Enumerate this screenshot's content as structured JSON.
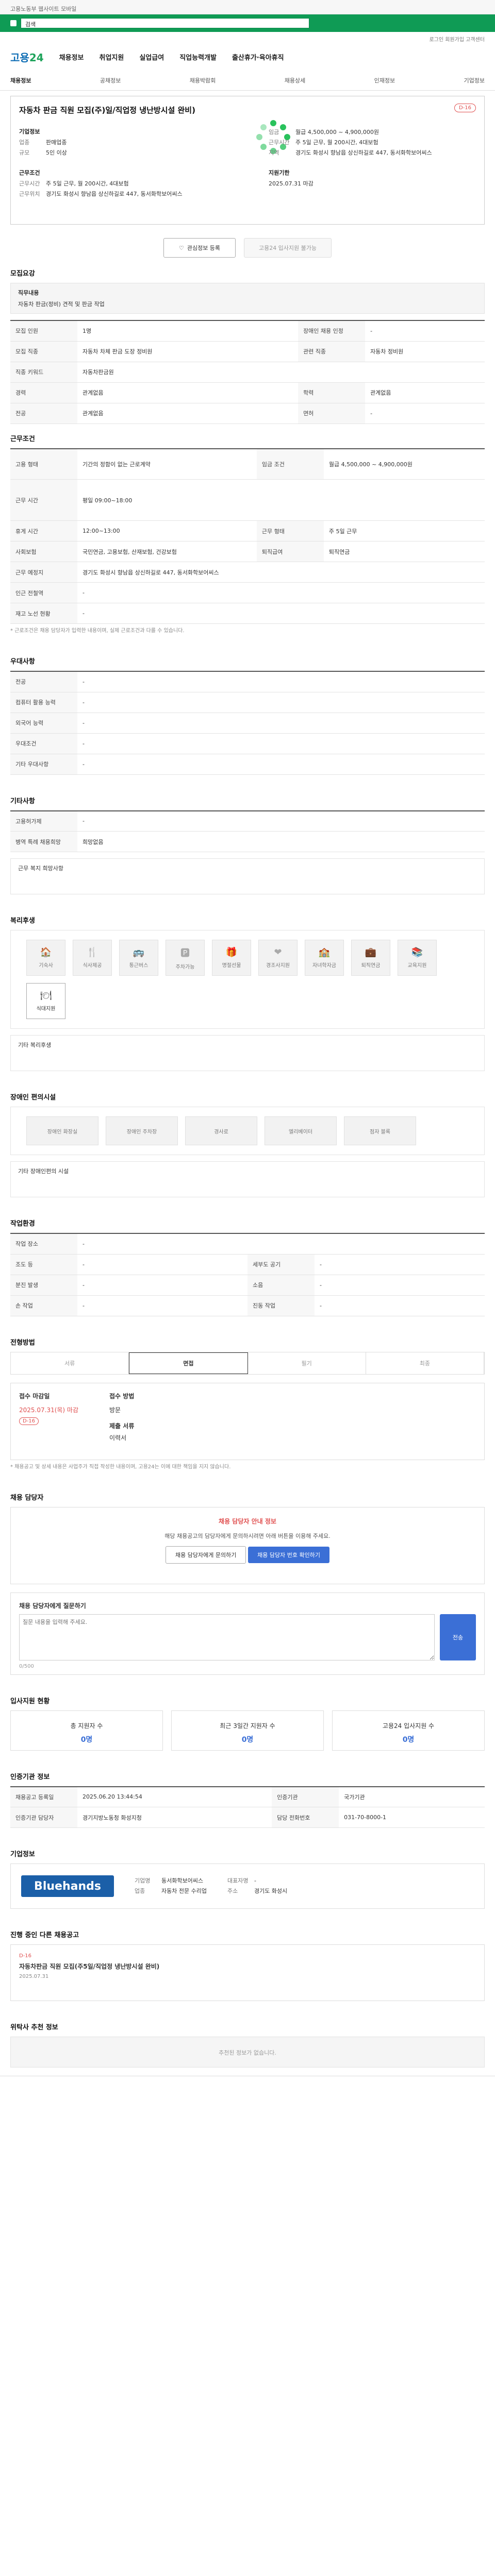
{
  "topbar": {
    "text": "고용노동부 웹사이트 모바일"
  },
  "search": {
    "value": "검색"
  },
  "util": {
    "text": "로그인  회원가입  고객센터"
  },
  "logo": {
    "main": "고용",
    "sub": "24"
  },
  "gnb": [
    "채용정보",
    "취업지원",
    "실업급여",
    "직업능력개발",
    "출산휴가·육아휴직"
  ],
  "subnav": [
    "채용정보",
    "공채정보",
    "채용박람회",
    "채용상세",
    "인재정보",
    "기업정보"
  ],
  "job": {
    "title": "자동차 판금 직원 모집(주)일/직업정 냉난방시설 완비)",
    "badge": "D-16",
    "company_label": "기업정보",
    "company_rows": [
      [
        "업종",
        "판매업종"
      ],
      [
        "규모",
        "5인 이상"
      ]
    ],
    "salary_label": "근무조건",
    "salary_rows": [
      [
        "임금",
        "월급 4,500,000 ~ 4,900,000원"
      ],
      [
        "근무시간",
        "주 5일 근무, 월 200시간, 4대보험"
      ]
    ],
    "loc_label": "근무위치",
    "loc_rows": [
      [
        "지역",
        "경기도 화성시 향남읍 상신하길로 447, 동서화학보어씨스"
      ]
    ],
    "apply_label": "지원기한",
    "apply_rows": [
      [
        "마감일",
        "2025.07.31 마감"
      ]
    ],
    "heart_label": "관심정보 등록",
    "apply_btn": "고용24 입사지원 불가능"
  },
  "sections": {
    "req": "모집요강",
    "req_box_title": "직무내용",
    "req_box_text": "자동차 판금(정비) 견적 및 판금 작업",
    "cond": "근무조건",
    "pref": "우대사항",
    "etc": "기타사항",
    "welfare": "복리후생",
    "disability": "장애인 편의시설",
    "env": "작업환경",
    "progress": "전형방법",
    "apply_method": "채용 담당자",
    "status": "입사지원 현황",
    "manager": "인증기관 정보",
    "company": "기업정보",
    "other_jobs": "진행 중인 다른 채용공고",
    "recommend": "위탁사 추천 정보"
  },
  "req_table": [
    [
      "모집 인원",
      "1명",
      "장애인 채용 인정",
      "-"
    ],
    [
      "모집 직종",
      "자동차 차체 판금 도장 정비원",
      "관련 직종",
      "자동차 정비원"
    ],
    [
      "직종 키워드",
      "자동차판금원",
      "",
      ""
    ],
    [
      "경력",
      "관계없음",
      "학력",
      "관계없음"
    ],
    [
      "전공",
      "관계없음",
      "면허",
      "-"
    ]
  ],
  "cond_table": [
    [
      "고용 형태",
      "기간의 정함이 없는 근로계약",
      "임금 조건",
      "월급 4,500,000 ~ 4,900,000원"
    ],
    [
      "근무 시간",
      "평일 09:00~18:00",
      "",
      ""
    ],
    [
      "휴게 시간",
      "12:00~13:00",
      "근무 형태",
      "주 5일 근무"
    ],
    [
      "사회보험",
      "국민연금, 고용보험, 산재보험, 건강보험",
      "퇴직급여",
      "퇴직연금"
    ],
    [
      "근무 예정지",
      "경기도 화성시 향남읍 상신하길로 447, 동서화학보어씨스",
      "",
      ""
    ],
    [
      "인근 전철역",
      "-",
      "",
      ""
    ],
    [
      "재고 노선 현황",
      "-",
      "",
      ""
    ]
  ],
  "cond_note": "* 근로조건은 채용 담당자가 입력한 내용이며, 실제 근로조건과 다를 수 있습니다.",
  "pref_table": [
    [
      "전공",
      "-"
    ],
    [
      "컴퓨터 활용 능력",
      "-"
    ],
    [
      "외국어 능력",
      "-"
    ],
    [
      "우대조건",
      "-"
    ],
    [
      "기타 우대사항",
      "-"
    ]
  ],
  "etc_table": [
    [
      "고용허가제",
      "-"
    ],
    [
      "병역 특례 채용희망",
      "희망없음"
    ]
  ],
  "etc_note": "근무 복지 희망사항",
  "welfare_items": [
    {
      "icon": "🏠",
      "label": "기숙사",
      "on": false
    },
    {
      "icon": "🍴",
      "label": "식사제공",
      "on": false
    },
    {
      "icon": "🚌",
      "label": "통근버스",
      "on": false
    },
    {
      "icon": "🅿",
      "label": "주차가능",
      "on": false
    },
    {
      "icon": "🎁",
      "label": "명절선물",
      "on": false
    },
    {
      "icon": "❤",
      "label": "경조사지원",
      "on": false
    },
    {
      "icon": "🏫",
      "label": "자녀학자금",
      "on": false
    },
    {
      "icon": "💼",
      "label": "퇴직연금",
      "on": false
    },
    {
      "icon": "📚",
      "label": "교육지원",
      "on": false
    },
    {
      "icon": "🍽",
      "label": "식대지원",
      "on": true
    }
  ],
  "welfare_note": "기타 복리후생",
  "disability_items": [
    "장애인 화장실",
    "장애인 주차장",
    "경사로",
    "엘리베이터",
    "점자 블록"
  ],
  "disability_note": "기타 장애인편의 시설",
  "env_table": [
    [
      "작업 장소",
      "-",
      "",
      ""
    ],
    [
      "조도 등",
      "-",
      "세부도 공기",
      "-"
    ],
    [
      "분진 발생",
      "-",
      "소음",
      "-"
    ],
    [
      "손 작업",
      "-",
      "진동 작업",
      "-"
    ]
  ],
  "steps": [
    "서류",
    "면접",
    "필기",
    "최종"
  ],
  "apply": {
    "date_label": "접수 마감일",
    "date": "2025.07.31(목) 마감",
    "dday": "D-16",
    "method_label": "접수 방법",
    "method": "방문",
    "docs_label": "제출 서류",
    "docs": "이력서"
  },
  "apply_notes": "* 채용공고 및 상세 내용은 사업주가 직접 작성한 내용이며, 고용24는 이에 대한 책임을 지지 않습니다.",
  "contact": {
    "title": "채용 담당자 안내 정보",
    "text": "해당 채용공고의 담당자에게 문의하시려면 아래 버튼을 이용해 주세요.",
    "btn1": "채용 담당자에게 문의하기",
    "btn2": "채용 담당자 번호 확인하기"
  },
  "question": {
    "title": "채용 담당자에게 질문하기",
    "placeholder": "질문 내용을 입력해 주세요.",
    "btn": "전송",
    "count": "0/500"
  },
  "status_cards": [
    {
      "label": "총 지원자 수",
      "n": "0명"
    },
    {
      "label": "최근 3일간 지원자 수",
      "n": "0명"
    },
    {
      "label": "고용24 입사지원 수",
      "n": "0명"
    }
  ],
  "manager_rows": [
    [
      "채용공고 등록일",
      "2025.06.20 13:44:54",
      "인증기관",
      "국가기관"
    ],
    [
      "인증기관 담당자",
      "경기지방노동청 화성지청",
      "담당 전화번호",
      "031-70-8000-1"
    ]
  ],
  "company_info": {
    "logo": "Bluehands",
    "rows": [
      [
        "기업명",
        "동서화학보어씨스"
      ],
      [
        "업종",
        "자동차 전문 수리업"
      ],
      [
        "대표자명",
        "-"
      ],
      [
        "주소",
        "경기도 화성시"
      ]
    ]
  },
  "other_job": {
    "title": "자동차판금 직원 모집(주5일/직업정 냉난방시설 완비)",
    "dday": "D-16",
    "date": "2025.07.31"
  },
  "recommend_text": "추천된 정보가 없습니다."
}
